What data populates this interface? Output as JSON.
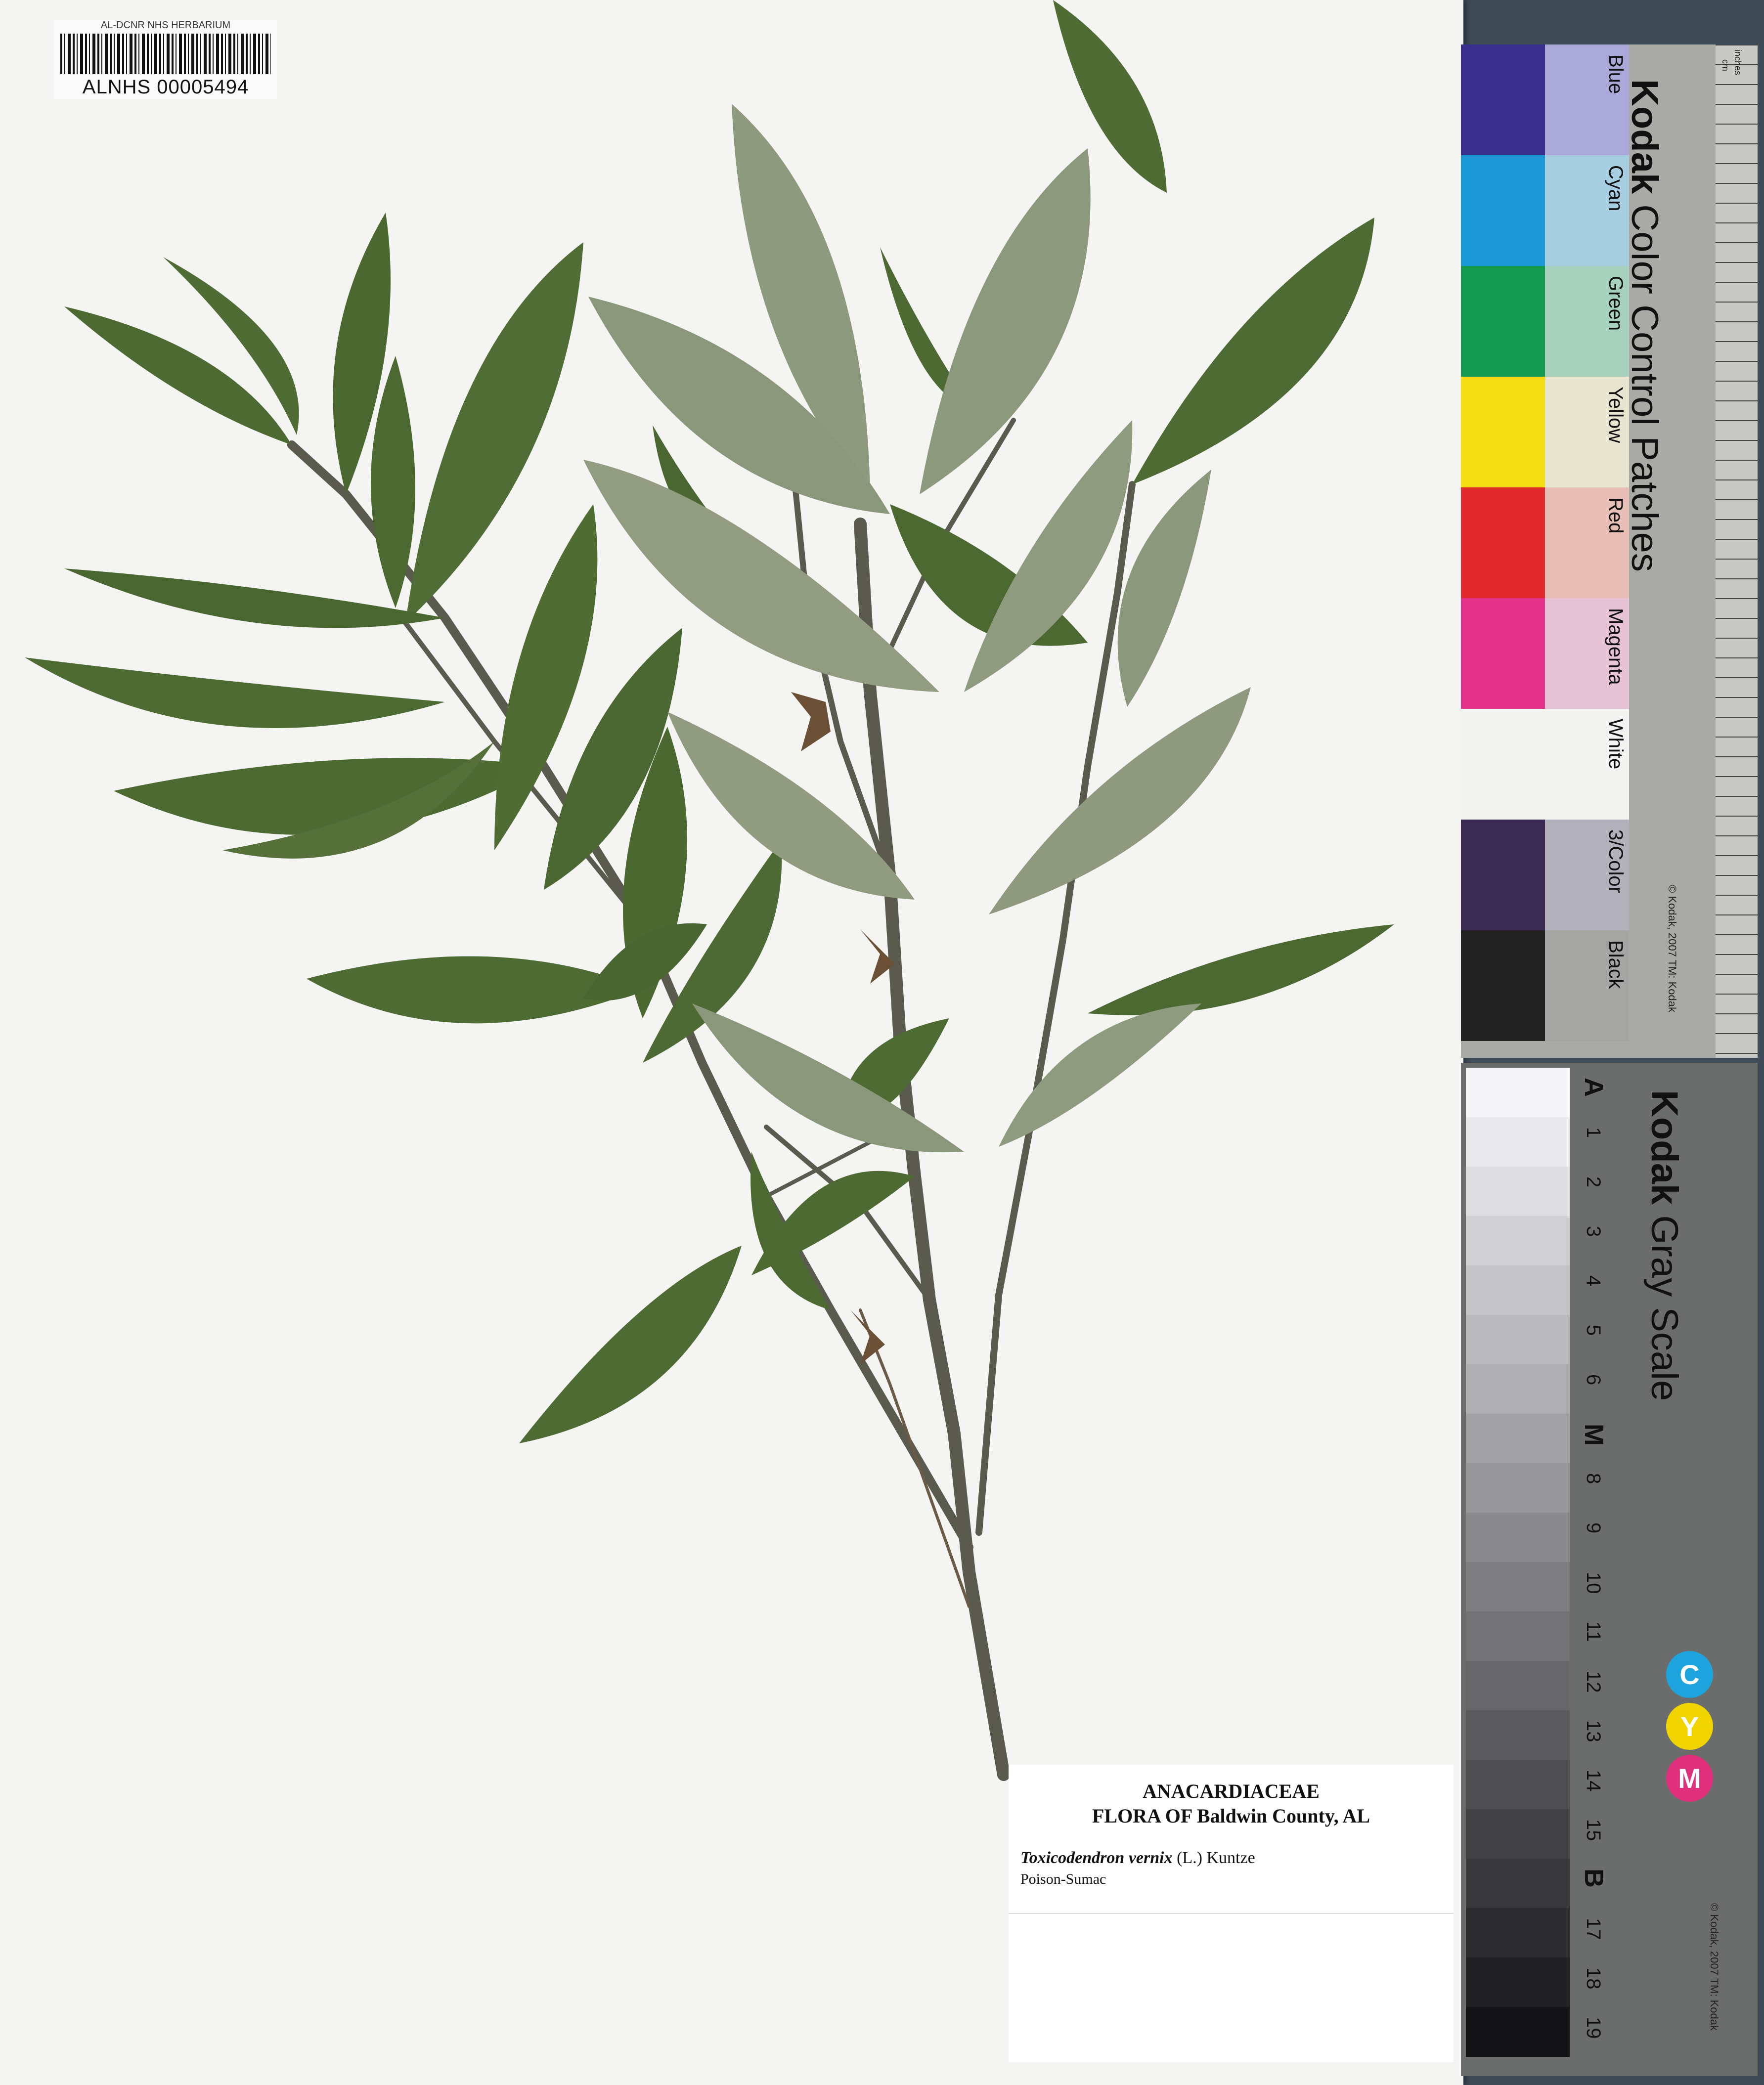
{
  "barcode": {
    "header": "AL-DCNR NHS HERBARIUM",
    "number": "ALNHS 00005494"
  },
  "label": {
    "family": "ANACARDIACEAE",
    "flora": "FLORA OF Baldwin County, AL",
    "scientific_name": "Toxicodendron vernix",
    "authority": "(L.) Kuntze",
    "common_name": "Poison-Sumac"
  },
  "color_card": {
    "brand": "Kodak",
    "title": "Color Control Patches",
    "copyright": "© Kodak, 2007 TM: Kodak",
    "ruler_units": [
      "inches",
      "cm"
    ],
    "patches": [
      {
        "name": "Blue",
        "dark": "#3a2f8c",
        "light": "#a9a8d6"
      },
      {
        "name": "Cyan",
        "dark": "#1b9ad6",
        "light": "#a7cde0"
      },
      {
        "name": "Green",
        "dark": "#139a50",
        "light": "#a6d2bd"
      },
      {
        "name": "Yellow",
        "dark": "#f4dc12",
        "light": "#e7e4cf"
      },
      {
        "name": "Red",
        "dark": "#e02a2d",
        "light": "#e8bfb6"
      },
      {
        "name": "Magenta",
        "dark": "#e4318a",
        "light": "#e5c3d5"
      },
      {
        "name": "White",
        "dark": "#f2f2f0",
        "light": "#f2f2f0"
      },
      {
        "name": "3/Color",
        "dark": "#3a2c52",
        "light": "#b2b1bb"
      },
      {
        "name": "Black",
        "dark": "#222222",
        "light": "#a5a6a3"
      }
    ]
  },
  "gray_card": {
    "brand": "Kodak",
    "title": "Gray Scale",
    "copyright": "© Kodak, 2007 TM: Kodak",
    "steps": [
      "A",
      "1",
      "2",
      "3",
      "4",
      "5",
      "6",
      "M",
      "8",
      "9",
      "10",
      "11",
      "12",
      "13",
      "14",
      "15",
      "B",
      "17",
      "18",
      "19"
    ],
    "cym": [
      {
        "letter": "C",
        "color": "#1ea4dc"
      },
      {
        "letter": "Y",
        "color": "#f0d400"
      },
      {
        "letter": "M",
        "color": "#e0307c"
      }
    ]
  },
  "colors": {
    "leaf_dark": "#4e6b34",
    "leaf_pale": "#8f9a7e",
    "stem": "#5a5a4e",
    "sheet": "#f4f5f3"
  }
}
